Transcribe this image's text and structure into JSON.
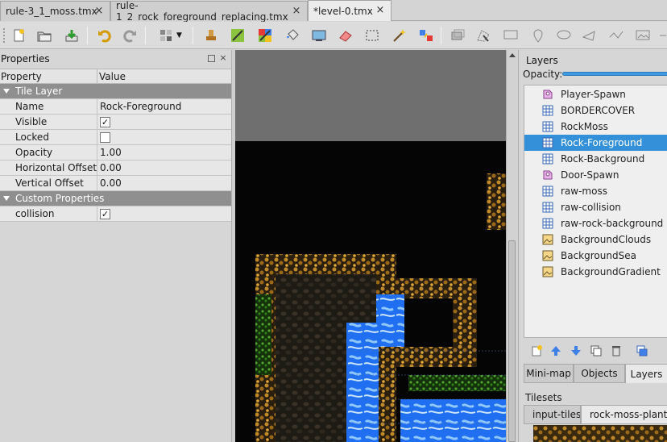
{
  "tabs": [
    {
      "label": "rule-3_1_moss.tmx",
      "active": false
    },
    {
      "label": "rule-1_2_rock_foreground_replacing.tmx",
      "active": false
    },
    {
      "label": "*level-0.tmx",
      "active": true
    }
  ],
  "tab_close_glyph": "×",
  "toolbar": {
    "buttons": [
      "new-map-icon",
      "open-file-icon",
      "save-icon",
      "undo-icon",
      "redo-icon",
      "automapping-icon",
      "stamp-brush-icon",
      "terrain-brush-icon",
      "random-icon",
      "bucket-fill-icon",
      "shape-fill-icon",
      "eraser-icon",
      "rectangular-select-icon",
      "magic-wand-icon",
      "select-same-tile-icon",
      "insert-tile-icon",
      "edit-polygon-icon",
      "insert-rectangle-icon",
      "insert-point-icon",
      "insert-ellipse-icon",
      "insert-polygon-icon",
      "insert-polyline-icon",
      "insert-image-icon"
    ]
  },
  "properties": {
    "title": "Properties",
    "headers": {
      "property": "Property",
      "value": "Value"
    },
    "rows": [
      {
        "kind": "group",
        "name": "Tile Layer"
      },
      {
        "kind": "text",
        "name": "Name",
        "value": "Rock-Foreground"
      },
      {
        "kind": "check",
        "name": "Visible",
        "checked": true
      },
      {
        "kind": "check",
        "name": "Locked",
        "checked": false
      },
      {
        "kind": "text",
        "name": "Opacity",
        "value": "1.00"
      },
      {
        "kind": "text",
        "name": "Horizontal Offset",
        "value": "0.00"
      },
      {
        "kind": "text",
        "name": "Vertical Offset",
        "value": "0.00"
      },
      {
        "kind": "group",
        "name": "Custom Properties"
      },
      {
        "kind": "check",
        "name": "collision",
        "checked": true
      }
    ],
    "check_glyph": "✓"
  },
  "layers": {
    "title": "Layers",
    "opacity_label": "Opacity:",
    "opacity_value": 1.0,
    "items": [
      {
        "name": "Player-Spawn",
        "type": "object",
        "selected": false
      },
      {
        "name": "BORDERCOVER",
        "type": "tile",
        "selected": false
      },
      {
        "name": "RockMoss",
        "type": "tile",
        "selected": false
      },
      {
        "name": "Rock-Foreground",
        "type": "tile",
        "selected": true
      },
      {
        "name": "Rock-Background",
        "type": "tile",
        "selected": false
      },
      {
        "name": "Door-Spawn",
        "type": "object",
        "selected": false
      },
      {
        "name": "raw-moss",
        "type": "tile",
        "selected": false
      },
      {
        "name": "raw-collision",
        "type": "tile",
        "selected": false
      },
      {
        "name": "raw-rock-background",
        "type": "tile",
        "selected": false
      },
      {
        "name": "BackgroundClouds",
        "type": "image",
        "selected": false
      },
      {
        "name": "BackgroundSea",
        "type": "image",
        "selected": false
      },
      {
        "name": "BackgroundGradient",
        "type": "image",
        "selected": false
      }
    ],
    "tools": [
      "add-layer-icon",
      "raise-layer-icon",
      "lower-layer-icon",
      "duplicate-layer-icon",
      "remove-layer-icon",
      "toggle-layers-icon"
    ]
  },
  "dock_tabs": [
    {
      "label": "Mini-map",
      "active": false
    },
    {
      "label": "Objects",
      "active": false
    },
    {
      "label": "Layers",
      "active": true
    }
  ],
  "tilesets": {
    "title": "Tilesets",
    "tabs": [
      {
        "label": "input-tiles",
        "active": false
      },
      {
        "label": "rock-moss-plants-do",
        "active": true
      }
    ]
  },
  "colors": {
    "selection": "#3490d8",
    "accent": "#3f9be0",
    "rock": "#b88a2a",
    "water": "#2f7fe8",
    "moss": "#3d8a2a"
  }
}
